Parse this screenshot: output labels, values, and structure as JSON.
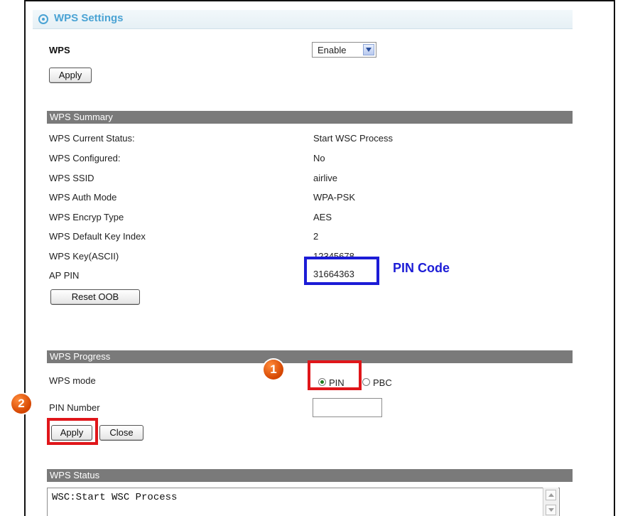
{
  "settings": {
    "title": "WPS Settings"
  },
  "wps": {
    "label": "WPS",
    "selected": "Enable",
    "apply_label": "Apply"
  },
  "summary": {
    "header": "WPS Summary",
    "rows": [
      {
        "label": "WPS Current Status:",
        "value": "Start WSC Process"
      },
      {
        "label": "WPS Configured:",
        "value": "No"
      },
      {
        "label": "WPS SSID",
        "value": "airlive"
      },
      {
        "label": "WPS Auth Mode",
        "value": "WPA-PSK"
      },
      {
        "label": "WPS Encryp Type",
        "value": "AES"
      },
      {
        "label": "WPS Default Key Index",
        "value": "2"
      },
      {
        "label": "WPS Key(ASCII)",
        "value": "12345678"
      },
      {
        "label": "AP PIN",
        "value": "31664363"
      }
    ],
    "reset_label": "Reset OOB"
  },
  "annotation": {
    "pin_code_label": "PIN Code",
    "step1": "1",
    "step2": "2"
  },
  "progress": {
    "header": "WPS Progress",
    "mode_label": "WPS mode",
    "option_pin": "PIN",
    "option_pbc": "PBC",
    "pin_number_label": "PIN Number",
    "apply_label": "Apply",
    "close_label": "Close"
  },
  "status": {
    "header": "WPS Status",
    "text": "WSC:Start WSC Process"
  },
  "colors": {
    "accent": "#4aa3d4",
    "section_bar": "#7a7a7a",
    "highlight_blue": "#1c1cd6",
    "highlight_red": "#e0161a",
    "badge": "#e05a10"
  }
}
